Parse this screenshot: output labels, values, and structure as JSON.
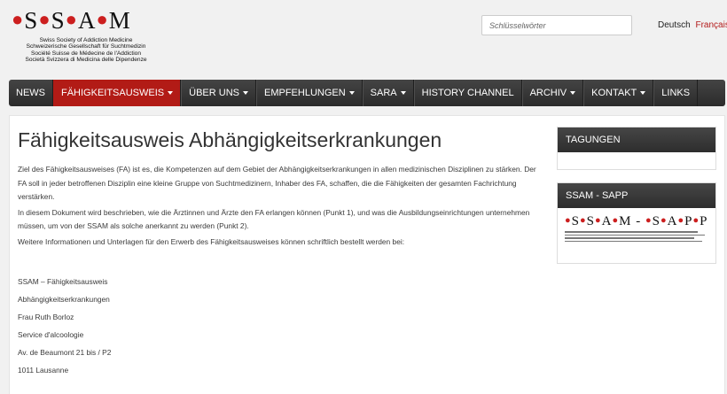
{
  "header": {
    "logo_lines": [
      "Swiss Society of Addiction Medicine",
      "Schweizerische Gesellschaft für Suchtmedizin",
      "Société Suisse de Médecine de l'Addiction",
      "Società Svizzera di Medicina delle Dipendenze"
    ],
    "search_placeholder": "Schlüsselwörter",
    "lang_de": "Deutsch",
    "lang_fr": "Français"
  },
  "nav": {
    "items": [
      {
        "label": "NEWS",
        "dropdown": false,
        "active": false
      },
      {
        "label": "FÄHIGKEITSAUSWEIS",
        "dropdown": true,
        "active": true
      },
      {
        "label": "ÜBER UNS",
        "dropdown": true,
        "active": false
      },
      {
        "label": "EMPFEHLUNGEN",
        "dropdown": true,
        "active": false
      },
      {
        "label": "SARA",
        "dropdown": true,
        "active": false
      },
      {
        "label": "HISTORY CHANNEL",
        "dropdown": false,
        "active": false
      },
      {
        "label": "ARCHIV",
        "dropdown": true,
        "active": false
      },
      {
        "label": "KONTAKT",
        "dropdown": true,
        "active": false
      },
      {
        "label": "LINKS",
        "dropdown": false,
        "active": false
      }
    ],
    "active_color": "#b21b16"
  },
  "main": {
    "title": "Fähigkeitsausweis Abhängigkeitserkrankungen",
    "paragraphs": [
      "Ziel des Fähigkeitsausweises (FA) ist es, die Kompetenzen auf dem Gebiet der Abhängigkeitserkrankungen in allen medizinischen Disziplinen zu stärken. Der FA soll in jeder betroffenen Disziplin eine kleine Gruppe von Suchtmedizinern, Inhaber des FA, schaffen, die die Fähigkeiten der gesamten Fachrichtung verstärken.",
      "In diesem Dokument wird beschrieben, wie die Ärztinnen und Ärzte den FA erlangen können (Punkt 1), und was die Ausbildungseinrichtungen unternehmen müssen, um von der SSAM als solche anerkannt zu werden (Punkt 2).",
      "Weitere Informationen und Unterlagen für den Erwerb des Fähigkeitsausweises können schriftlich bestellt werden bei:"
    ],
    "address": [
      "SSAM – Fähigkeitsausweis",
      "Abhängigkeitserkrankungen",
      "Frau Ruth Borloz",
      "Service d'alcoologie",
      "Av. de Beaumont 21 bis / P2",
      "1011 Lausanne"
    ]
  },
  "sidebar": {
    "widget1_title": "TAGUNGEN",
    "widget2_title": "SSAM - SAPP"
  }
}
